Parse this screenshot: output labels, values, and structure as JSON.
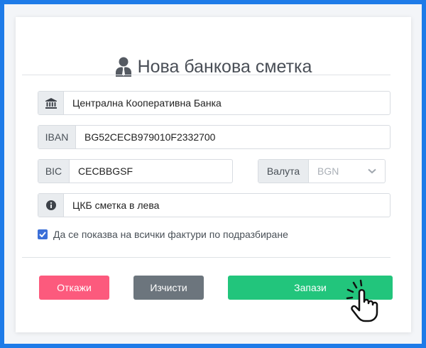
{
  "form": {
    "title": "Нова банкова сметка",
    "bank_name": "Централна Кооперативна Банка",
    "iban_label": "IBAN",
    "iban_value": "BG52CECB979010F2332700",
    "bic_label": "BIC",
    "bic_value": "CECBBGSF",
    "currency_label": "Валута",
    "currency_value": "BGN",
    "description": "ЦКБ сметка в лева",
    "default_checkbox_label": "Да се показва на всички фактури по подразбиране",
    "default_checked": true
  },
  "buttons": {
    "cancel": "Откажи",
    "clear": "Изчисти",
    "save": "Запази"
  },
  "colors": {
    "cancel": "#fc5a7d",
    "clear": "#6c757d",
    "save": "#22c57c",
    "checkbox": "#3b6fd8"
  },
  "icons": {
    "title": "user-icon",
    "bank": "bank-icon",
    "info": "info-icon",
    "select": "chevron-down-icon",
    "cursor": "pointing-hand-icon"
  }
}
